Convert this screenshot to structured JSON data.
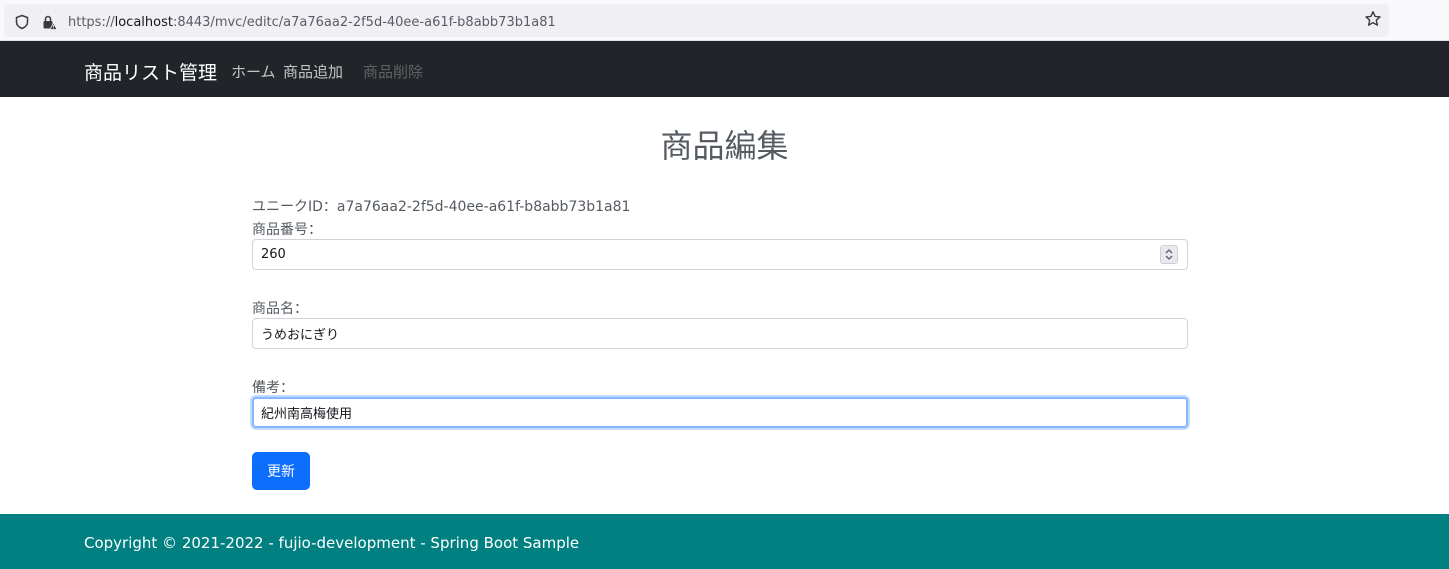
{
  "browser": {
    "url_prefix": "https://",
    "url_host": "localhost",
    "url_rest": ":8443/mvc/editc/a7a76aa2-2f5d-40ee-a61f-b8abb73b1a81",
    "icons": [
      "shield-icon",
      "lock-icon",
      "star-icon"
    ]
  },
  "navbar": {
    "brand": "商品リスト管理",
    "links": [
      {
        "label": "ホーム",
        "state": "active"
      },
      {
        "label": "商品追加",
        "state": "active"
      },
      {
        "label": "商品削除",
        "state": "disabled"
      }
    ],
    "background": "#212529"
  },
  "main": {
    "title": "商品編集",
    "uid_label": "ユニークID：",
    "uid_value": "a7a76aa2-2f5d-40ee-a61f-b8abb73b1a81",
    "fields": [
      {
        "label": "商品番号：",
        "value": "260",
        "type": "number"
      },
      {
        "label": "商品名：",
        "value": "うめおにぎり",
        "type": "text"
      },
      {
        "label": "備考：",
        "value": "紀州南高梅使用",
        "type": "text",
        "focused": true
      }
    ],
    "submit_label": "更新",
    "accent": "#0d6efd"
  },
  "footer": {
    "text": "Copyright © 2021-2022 - fujio-development - Spring Boot Sample",
    "background": "#008080"
  }
}
